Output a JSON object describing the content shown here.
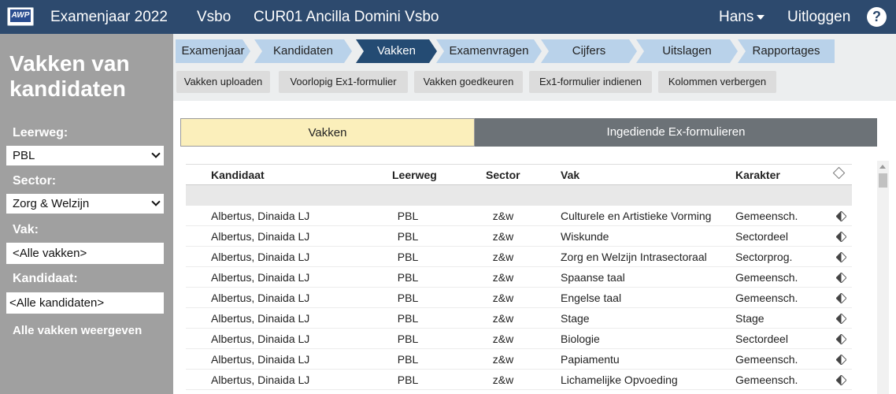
{
  "topbar": {
    "logo": "AWP",
    "exam_year": "Examenjaar 2022",
    "department": "Vsbo",
    "school": "CUR01 Ancilla Domini Vsbo",
    "user": "Hans",
    "logout": "Uitloggen",
    "help": "?"
  },
  "sidebar": {
    "title": "Vakken van kandidaten",
    "leerweg_label": "Leerweg:",
    "leerweg_value": "PBL",
    "sector_label": "Sector:",
    "sector_value": "Zorg & Welzijn",
    "vak_label": "Vak:",
    "vak_value": "<Alle vakken>",
    "kandidaat_label": "Kandidaat:",
    "kandidaat_value": "<Alle kandidaten>",
    "show_all": "Alle vakken weergeven"
  },
  "steps": [
    "Examenjaar",
    "Kandidaten",
    "Vakken",
    "Examenvragen",
    "Cijfers",
    "Uitslagen",
    "Rapportages"
  ],
  "active_step": "Vakken",
  "colors": {
    "nav": "#2d4a6e",
    "step": "#b9d2ea",
    "step_active": "#244b73",
    "toggle_active": "#fbefbb",
    "toggle_inactive": "#6c7277"
  },
  "actions": [
    "Vakken uploaden",
    "Voorlopig Ex1-formulier",
    "Vakken goedkeuren",
    "Ex1-formulier indienen",
    "Kolommen verbergen"
  ],
  "toggle": {
    "left": "Vakken",
    "right": "Ingediende Ex-formulieren"
  },
  "table": {
    "headers": {
      "kandidaat": "Kandidaat",
      "leerweg": "Leerweg",
      "sector": "Sector",
      "vak": "Vak",
      "karakter": "Karakter"
    },
    "rows": [
      {
        "kandidaat": "Albertus, Dinaida LJ",
        "leerweg": "PBL",
        "sector": "z&w",
        "vak": "Culturele en Artistieke Vorming",
        "karakter": "Gemeensch."
      },
      {
        "kandidaat": "Albertus, Dinaida LJ",
        "leerweg": "PBL",
        "sector": "z&w",
        "vak": "Wiskunde",
        "karakter": "Sectordeel"
      },
      {
        "kandidaat": "Albertus, Dinaida LJ",
        "leerweg": "PBL",
        "sector": "z&w",
        "vak": "Zorg en Welzijn Intrasectoraal",
        "karakter": "Sectorprog."
      },
      {
        "kandidaat": "Albertus, Dinaida LJ",
        "leerweg": "PBL",
        "sector": "z&w",
        "vak": "Spaanse taal",
        "karakter": "Gemeensch."
      },
      {
        "kandidaat": "Albertus, Dinaida LJ",
        "leerweg": "PBL",
        "sector": "z&w",
        "vak": "Engelse taal",
        "karakter": "Gemeensch."
      },
      {
        "kandidaat": "Albertus, Dinaida LJ",
        "leerweg": "PBL",
        "sector": "z&w",
        "vak": "Stage",
        "karakter": "Stage"
      },
      {
        "kandidaat": "Albertus, Dinaida LJ",
        "leerweg": "PBL",
        "sector": "z&w",
        "vak": "Biologie",
        "karakter": "Sectordeel"
      },
      {
        "kandidaat": "Albertus, Dinaida LJ",
        "leerweg": "PBL",
        "sector": "z&w",
        "vak": "Papiamentu",
        "karakter": "Gemeensch."
      },
      {
        "kandidaat": "Albertus, Dinaida LJ",
        "leerweg": "PBL",
        "sector": "z&w",
        "vak": "Lichamelijke Opvoeding",
        "karakter": "Gemeensch."
      }
    ]
  }
}
